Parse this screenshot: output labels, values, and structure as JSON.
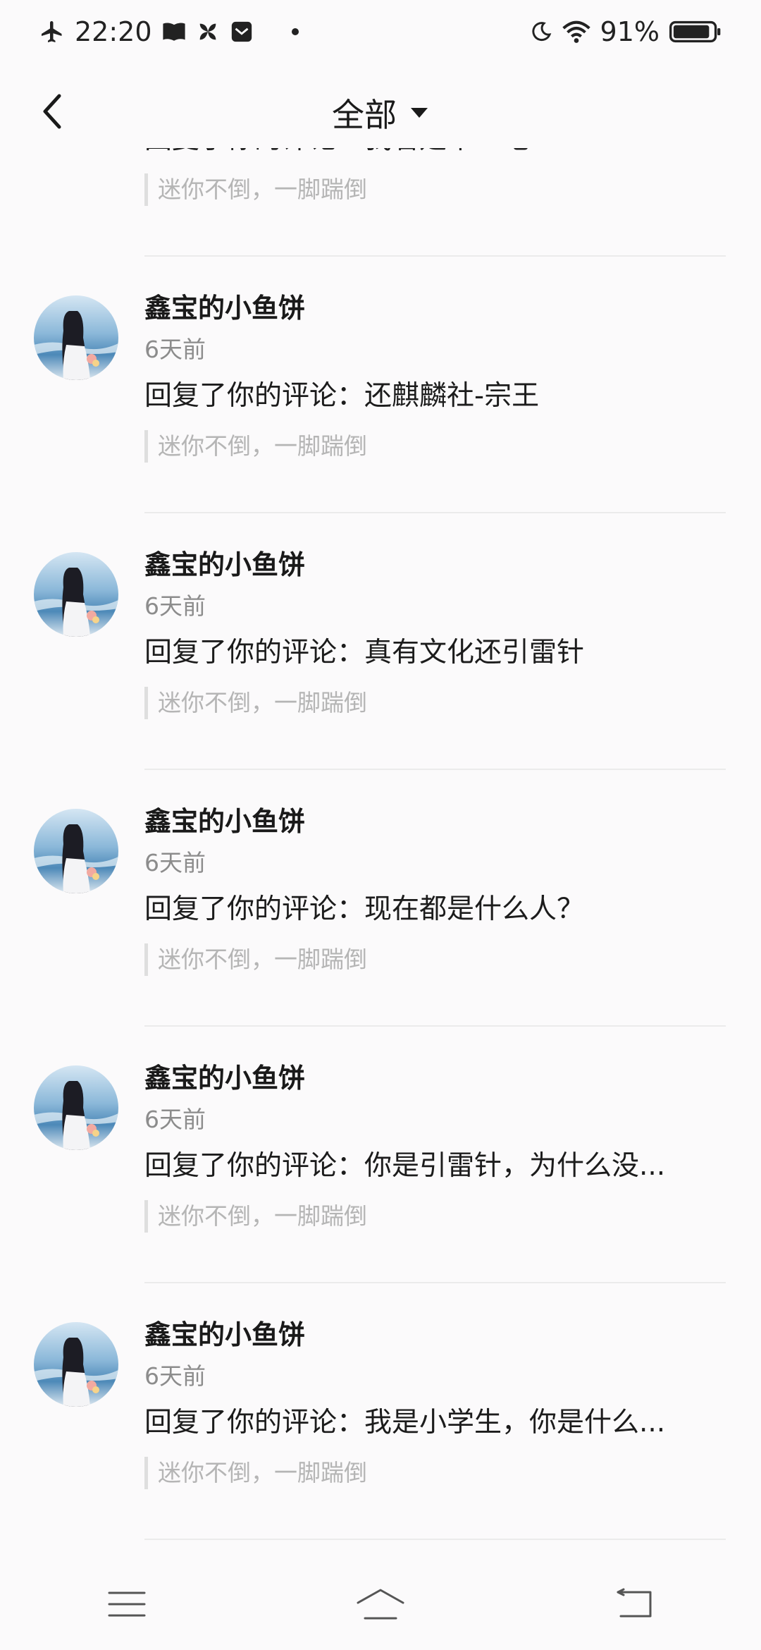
{
  "status_bar": {
    "time": "22:20",
    "battery_percent": "91%",
    "battery_level": 0.91,
    "icons": [
      "airplane-icon",
      "book-icon",
      "pinwheel-icon",
      "mail-icon",
      "moon-icon",
      "wifi-icon",
      "battery-icon"
    ]
  },
  "header": {
    "back_icon": "chevron-left-icon",
    "title": "全部",
    "dropdown_icon": "caret-down-icon"
  },
  "list": {
    "items": [
      {
        "name": "",
        "time": "",
        "reply": "回复了你的评论：我看是中二吧",
        "quote": "迷你不倒，一脚踹倒"
      },
      {
        "name": "鑫宝的小鱼饼",
        "time": "6天前",
        "reply": "回复了你的评论：还麒麟社-宗王",
        "quote": "迷你不倒，一脚踹倒"
      },
      {
        "name": "鑫宝的小鱼饼",
        "time": "6天前",
        "reply": "回复了你的评论：真有文化还引雷针",
        "quote": "迷你不倒，一脚踹倒"
      },
      {
        "name": "鑫宝的小鱼饼",
        "time": "6天前",
        "reply": "回复了你的评论：现在都是什么人？",
        "quote": "迷你不倒，一脚踹倒"
      },
      {
        "name": "鑫宝的小鱼饼",
        "time": "6天前",
        "reply": "回复了你的评论：你是引雷针，为什么没...",
        "quote": "迷你不倒，一脚踹倒"
      },
      {
        "name": "鑫宝的小鱼饼",
        "time": "6天前",
        "reply": "回复了你的评论：我是小学生，你是什么...",
        "quote": "迷你不倒，一脚踹倒"
      }
    ]
  },
  "nav_bar": {
    "icons": [
      "menu-icon",
      "home-icon",
      "back-icon"
    ]
  },
  "colors": {
    "background": "#fbfafb",
    "text_primary": "#1a1a1a",
    "text_secondary": "#8c8c8c",
    "quote_text": "#b5b5b5",
    "divider": "#ebebeb"
  }
}
